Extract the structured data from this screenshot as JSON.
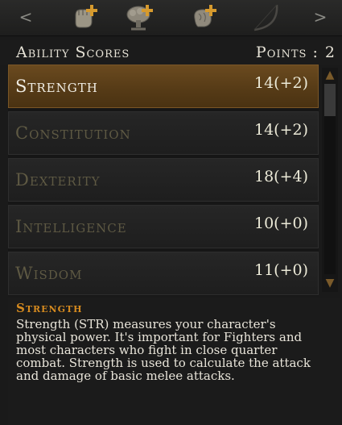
{
  "tabs": {
    "prev_label": "<",
    "next_label": ">",
    "items": [
      {
        "icon": "fist-plus-icon"
      },
      {
        "icon": "tree-plus-icon"
      },
      {
        "icon": "brain-plus-icon"
      },
      {
        "icon": "bow-icon"
      }
    ]
  },
  "header": {
    "title": "Ability Scores",
    "points_label": "Points :",
    "points_value": "2"
  },
  "abilities": [
    {
      "name": "Strength",
      "score": "14(+2)",
      "selected": true
    },
    {
      "name": "Constitution",
      "score": "14(+2)",
      "selected": false
    },
    {
      "name": "Dexterity",
      "score": "18(+4)",
      "selected": false
    },
    {
      "name": "Intelligence",
      "score": "10(+0)",
      "selected": false
    },
    {
      "name": "Wisdom",
      "score": "11(+0)",
      "selected": false
    }
  ],
  "description": {
    "title": "Strength",
    "lines": [
      "Strength (STR) measures your character's",
      "physical power. It's important for Fighters and",
      "most characters who fight in close quarter",
      "combat. Strength is used to calculate the attack",
      "and damage of basic melee attacks."
    ]
  },
  "colors": {
    "selected_bg": "#6a4a1f",
    "accent": "#d58a1f",
    "plus": "#d69a2e"
  }
}
